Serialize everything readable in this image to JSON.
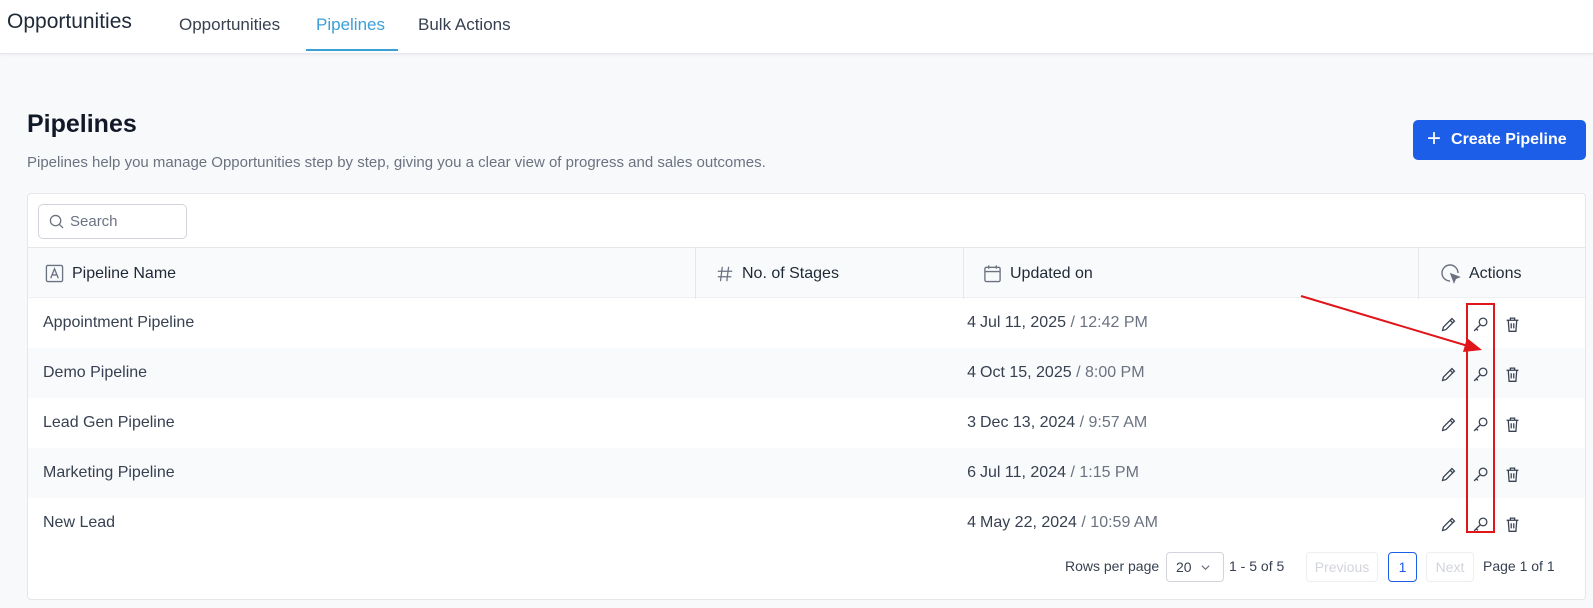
{
  "app": {
    "title": "Opportunities",
    "tabs": [
      {
        "label": "Opportunities",
        "active": false
      },
      {
        "label": "Pipelines",
        "active": true
      },
      {
        "label": "Bulk Actions",
        "active": false
      }
    ]
  },
  "header": {
    "title": "Pipelines",
    "description": "Pipelines help you manage Opportunities step by step, giving you a clear view of progress and sales outcomes.",
    "create_button_label": "Create Pipeline"
  },
  "search": {
    "placeholder": "Search",
    "value": ""
  },
  "table": {
    "columns": [
      {
        "label": "Pipeline Name",
        "icon": "text-a-icon"
      },
      {
        "label": "No. of Stages",
        "icon": "hash-icon"
      },
      {
        "label": "Updated on",
        "icon": "calendar-icon"
      },
      {
        "label": "Actions",
        "icon": "cursor-click-icon"
      }
    ],
    "rows": [
      {
        "name": "Appointment Pipeline",
        "stages": "4",
        "date": "Jul 11, 2025",
        "time": "12:42 PM"
      },
      {
        "name": "Demo Pipeline",
        "stages": "4",
        "date": "Oct 15, 2025",
        "time": "8:00 PM"
      },
      {
        "name": "Lead Gen Pipeline",
        "stages": "3",
        "date": "Dec 13, 2024",
        "time": "9:57 AM"
      },
      {
        "name": "Marketing Pipeline",
        "stages": "6",
        "date": "Jul 11, 2024",
        "time": "1:15 PM"
      },
      {
        "name": "New Lead",
        "stages": "4",
        "date": "May 22, 2024",
        "time": "10:59 AM"
      }
    ]
  },
  "pagination": {
    "rows_per_page_label": "Rows per page",
    "rows_per_page_value": "20",
    "range": "1 - 5 of 5",
    "previous_label": "Previous",
    "current_page": "1",
    "next_label": "Next",
    "page_of": "Page 1 of 1"
  },
  "colors": {
    "accent": "#1d5ee8",
    "active_tab": "#3b9fd8",
    "annotation": "#e0161b"
  }
}
